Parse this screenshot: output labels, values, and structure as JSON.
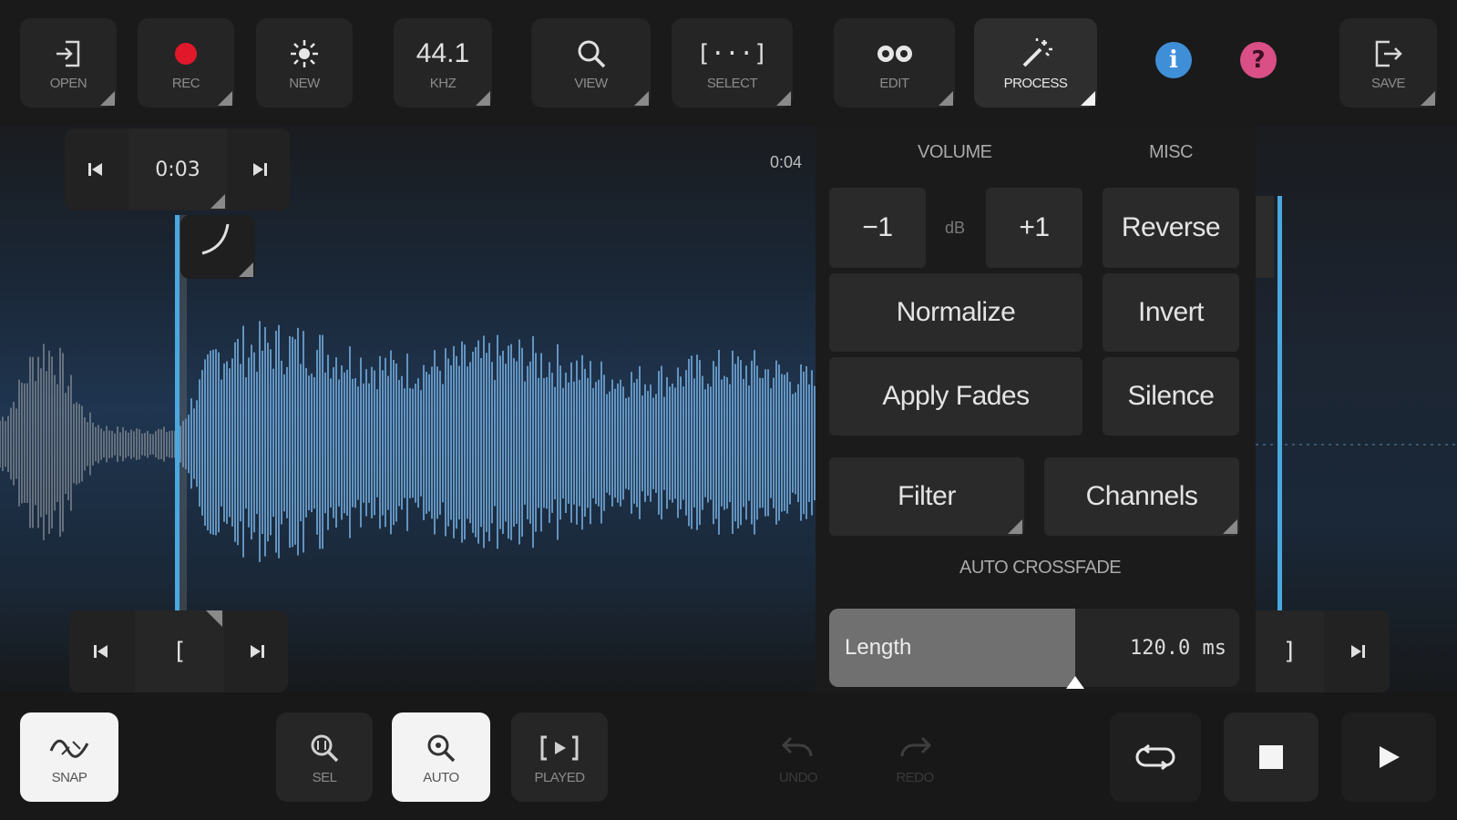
{
  "toolbar": {
    "open": "OPEN",
    "rec": "REC",
    "new": "NEW",
    "rate_value": "44.1",
    "rate_unit": "KHZ",
    "view": "VIEW",
    "select_icon_text": "[···]",
    "select": "SELECT",
    "edit": "EDIT",
    "process": "PROCESS",
    "info": "i",
    "help": "?",
    "save": "SAVE"
  },
  "transport_top": {
    "time": "0:03",
    "end_time": "0:04"
  },
  "markers": {
    "start_bracket": "[",
    "end_bracket": "]"
  },
  "process_panel": {
    "volume_header": "VOLUME",
    "misc_header": "MISC",
    "minus_one": "−1",
    "db_label": "dB",
    "plus_one": "+1",
    "normalize": "Normalize",
    "apply_fades": "Apply Fades",
    "reverse": "Reverse",
    "invert": "Invert",
    "silence": "Silence",
    "filter": "Filter",
    "channels": "Channels",
    "crossfade_header": "AUTO CROSSFADE",
    "length_label": "Length",
    "length_value": "120.0 ms",
    "length_fraction": 0.6
  },
  "bottom": {
    "snap": "SNAP",
    "sel": "SEL",
    "auto": "AUTO",
    "played": "PLAYED",
    "undo": "UNDO",
    "redo": "REDO"
  },
  "colors": {
    "accent_blue": "#4aa8e0",
    "rec_red": "#e0182a",
    "info_blue": "#3f8fd8",
    "help_pink": "#d94f86",
    "waveform": "#6fa6d6"
  }
}
